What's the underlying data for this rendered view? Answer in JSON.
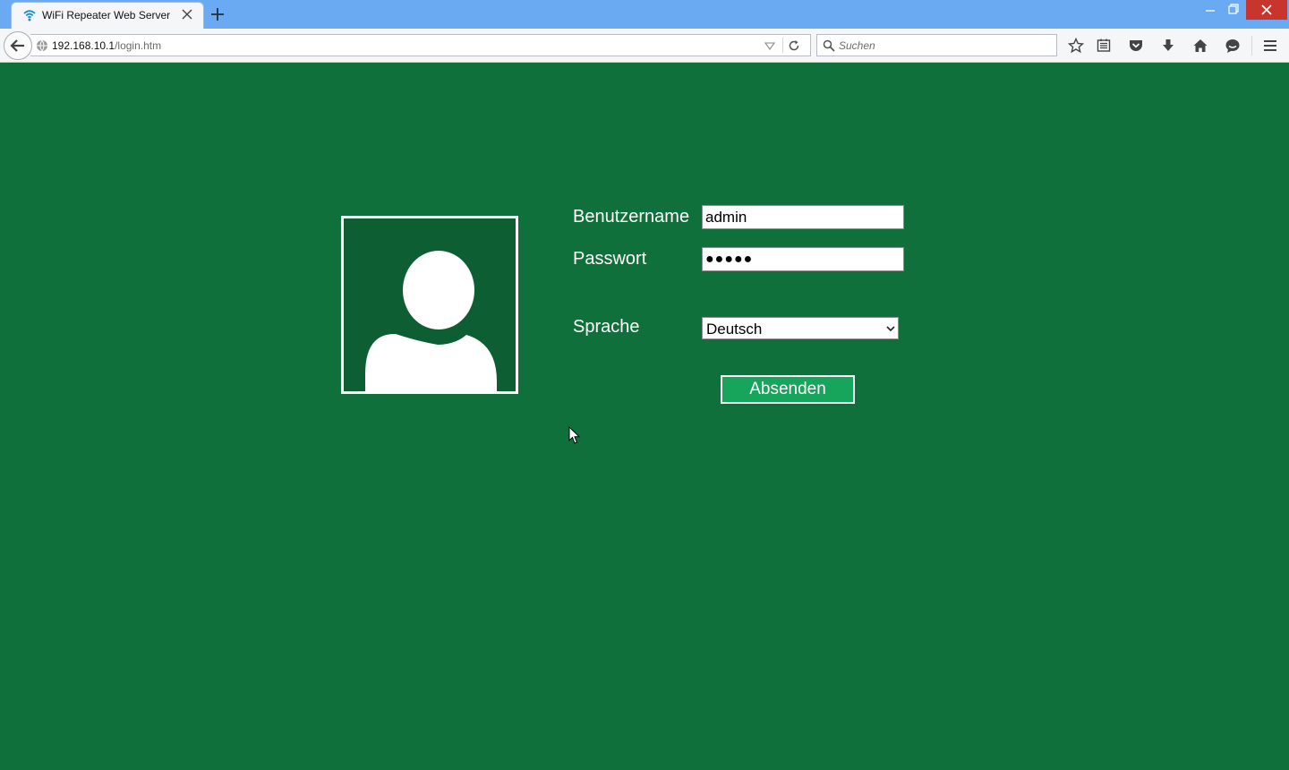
{
  "browser": {
    "tab": {
      "title": "WiFi Repeater Web Server"
    },
    "address": {
      "host": "192.168.10.1",
      "path": "/login.htm"
    },
    "search": {
      "placeholder": "Suchen"
    }
  },
  "login": {
    "username_label": "Benutzername",
    "username_value": "admin",
    "password_label": "Passwort",
    "password_mask": "●●●●●",
    "language_label": "Sprache",
    "language_selected": "Deutsch",
    "submit_label": "Absenden"
  },
  "colors": {
    "page_background": "#0f703c",
    "avatar_background": "#0d5e32",
    "submit_background": "#16a55a",
    "titlebar": "#6aaaf2"
  }
}
